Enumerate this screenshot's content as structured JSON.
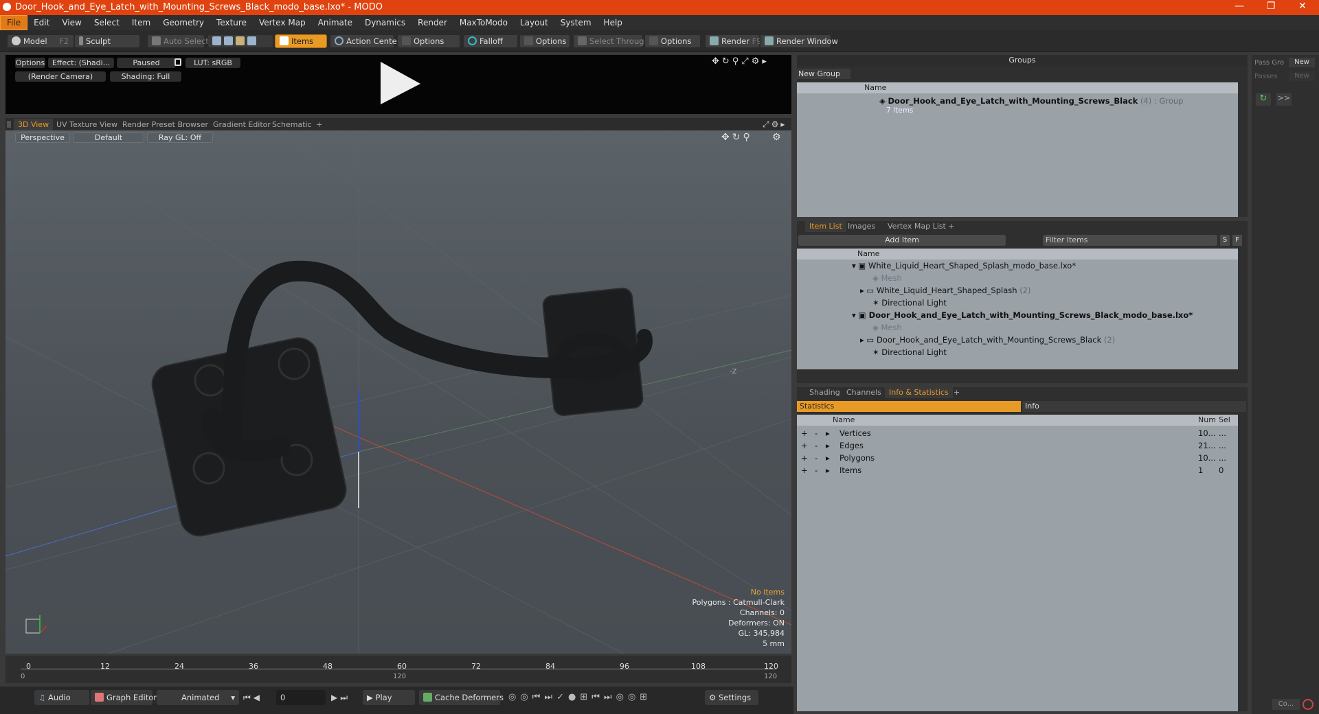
{
  "window": {
    "title": "Door_Hook_and_Eye_Latch_with_Mounting_Screws_Black_modo_base.lxo* - MODO"
  },
  "menu": [
    "File",
    "Edit",
    "View",
    "Select",
    "Item",
    "Geometry",
    "Texture",
    "Vertex Map",
    "Animate",
    "Dynamics",
    "Render",
    "MaxToModo",
    "Layout",
    "System",
    "Help"
  ],
  "toolbar": {
    "model": "Model",
    "model_key": "F2",
    "sculpt": "Sculpt",
    "auto_select": "Auto Select",
    "items": "Items",
    "action_center": "Action Center",
    "options1": "Options",
    "falloff": "Falloff",
    "options2": "Options",
    "select_through": "Select Through",
    "options3": "Options",
    "render": "Render",
    "render_key": "F9",
    "render_window": "Render Window"
  },
  "preview": {
    "options": "Options",
    "effect": "Effect: (Shadi...",
    "paused": "Paused",
    "lut": "LUT: sRGB",
    "camera": "(Render Camera)",
    "shading": "Shading: Full"
  },
  "viewport_tabs": [
    "3D View",
    "UV Texture View",
    "Render Preset Browser",
    "Gradient Editor",
    "Schematic",
    "+"
  ],
  "viewport": {
    "perspective": "Perspective",
    "default": "Default",
    "raygl": "Ray GL: Off",
    "axis_label": "-Z",
    "stats": {
      "no_items": "No Items",
      "polygons": "Polygons : Catmull-Clark",
      "channels": "Channels: 0",
      "deformers": "Deformers: ON",
      "gl": "GL: 345,984",
      "unit": "5 mm"
    }
  },
  "timeline": {
    "ticks": [
      "0",
      "12",
      "24",
      "36",
      "48",
      "60",
      "72",
      "84",
      "96",
      "108",
      "120"
    ],
    "start": "0",
    "mid": "120",
    "end": "120"
  },
  "bottom": {
    "audio": "Audio",
    "graph_editor": "Graph Editor",
    "animated": "Animated",
    "frame": "0",
    "play": "Play",
    "cache_deformers": "Cache Deformers",
    "settings": "Settings"
  },
  "groups": {
    "title": "Groups",
    "new_group": "New Group",
    "name_col": "Name",
    "group_name": "Door_Hook_and_Eye_Latch_with_Mounting_Screws_Black",
    "group_count": "(4)",
    "group_type": ": Group",
    "group_items": "7 Items"
  },
  "passes": {
    "pass_label": "Pass Gro",
    "new": "New",
    "passes_label": "Passes",
    "new2": "New",
    "co": "Co..."
  },
  "item_list": {
    "tabs": [
      "Item List",
      "Images",
      "Vertex Map List",
      "+"
    ],
    "add_item": "Add Item",
    "filter": "Filter Items",
    "s": "S",
    "f": "F",
    "name_col": "Name",
    "rows": [
      {
        "label": "White_Liquid_Heart_Shaped_Splash_modo_base.lxo*",
        "indent": 0,
        "type": "scene"
      },
      {
        "label": "Mesh",
        "indent": 1,
        "type": "mesh"
      },
      {
        "label": "White_Liquid_Heart_Shaped_Splash",
        "count": "(2)",
        "indent": 1,
        "type": "group"
      },
      {
        "label": "Directional Light",
        "indent": 1,
        "type": "light"
      },
      {
        "label": "Door_Hook_and_Eye_Latch_with_Mounting_Screws_Black_modo_base.lxo*",
        "indent": 0,
        "type": "scene-bold"
      },
      {
        "label": "Mesh",
        "indent": 1,
        "type": "mesh"
      },
      {
        "label": "Door_Hook_and_Eye_Latch_with_Mounting_Screws_Black",
        "count": "(2)",
        "indent": 1,
        "type": "group"
      },
      {
        "label": "Directional Light",
        "indent": 1,
        "type": "light"
      }
    ]
  },
  "info": {
    "tabs": [
      "Shading",
      "Channels",
      "Info & Statistics",
      "+"
    ],
    "statistics": "Statistics",
    "info": "Info",
    "cols": {
      "name": "Name",
      "num": "Num",
      "sel": "Sel"
    },
    "rows": [
      {
        "name": "Vertices",
        "num": "10...",
        "sel": "..."
      },
      {
        "name": "Edges",
        "num": "21...",
        "sel": "..."
      },
      {
        "name": "Polygons",
        "num": "10...",
        "sel": "..."
      },
      {
        "name": "Items",
        "num": "1",
        "sel": "0"
      }
    ]
  },
  "colors": {
    "title_bar": "#e0430f",
    "accent": "#e89a27",
    "viewport": "#4f565b"
  }
}
